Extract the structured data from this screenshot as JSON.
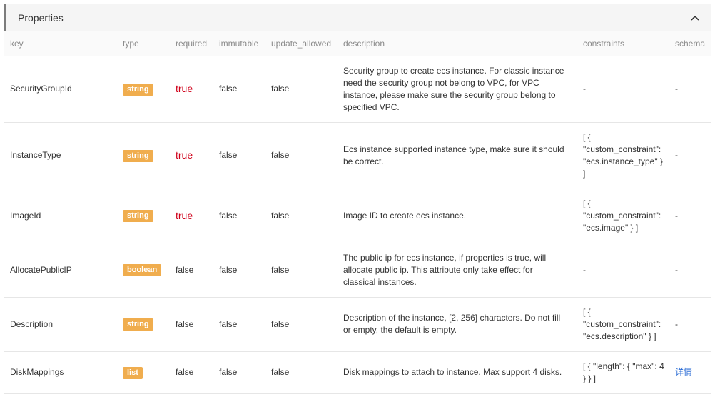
{
  "panel": {
    "title": "Properties",
    "collapse_icon": "chevron-up-icon"
  },
  "columns": [
    "key",
    "type",
    "required",
    "immutable",
    "update_allowed",
    "description",
    "constraints",
    "schema"
  ],
  "rows": [
    {
      "key": "SecurityGroupId",
      "type": "string",
      "required": "true",
      "immutable": "false",
      "update_allowed": "false",
      "description": "Security group to create ecs instance. For classic instance need the security group not belong to VPC, for VPC instance, please make sure the security group belong to specified VPC.",
      "constraints": "-",
      "schema": "-"
    },
    {
      "key": "InstanceType",
      "type": "string",
      "required": "true",
      "immutable": "false",
      "update_allowed": "false",
      "description": "Ecs instance supported instance type, make sure it should be correct.",
      "constraints": "[ { \"custom_constraint\": \"ecs.instance_type\" } ]",
      "schema": "-"
    },
    {
      "key": "ImageId",
      "type": "string",
      "required": "true",
      "immutable": "false",
      "update_allowed": "false",
      "description": "Image ID to create ecs instance.",
      "constraints": "[ { \"custom_constraint\": \"ecs.image\" } ]",
      "schema": "-"
    },
    {
      "key": "AllocatePublicIP",
      "type": "boolean",
      "required": "false",
      "immutable": "false",
      "update_allowed": "false",
      "description": "The public ip for ecs instance, if properties is true, will allocate public ip. This attribute only take effect for classical instances.",
      "constraints": "-",
      "schema": "-"
    },
    {
      "key": "Description",
      "type": "string",
      "required": "false",
      "immutable": "false",
      "update_allowed": "false",
      "description": "Description of the instance, [2, 256] characters. Do not fill or empty, the default is empty.",
      "constraints": "[ { \"custom_constraint\": \"ecs.description\" } ]",
      "schema": "-"
    },
    {
      "key": "DiskMappings",
      "type": "list",
      "required": "false",
      "immutable": "false",
      "update_allowed": "false",
      "description": "Disk mappings to attach to instance. Max support 4 disks.",
      "constraints": "[ { \"length\": { \"max\": 4 } } ]",
      "schema": "详情"
    }
  ],
  "colors": {
    "tag": "#f0ad4e",
    "required_true": "#d0021b",
    "link": "#2b6cd4"
  }
}
